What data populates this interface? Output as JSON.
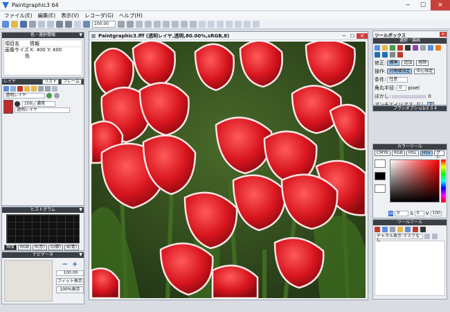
{
  "app": {
    "title": "Paintgraphic3 64"
  },
  "menu": [
    "ファイル(E)",
    "編集(E)",
    "表示(V)",
    "レコーダ(G)",
    "ヘルプ(H)"
  ],
  "toolbar": {
    "zoom": "100.00"
  },
  "info_panel": {
    "title": "色・選択情報",
    "col_item": "項目名",
    "col_info": "情報",
    "size_label": "画像サイズ",
    "size_value": "X: 400 Y: 400",
    "color_label": "色"
  },
  "layer_panel": {
    "title": "レイヤ",
    "tab1": "リスト",
    "tab2": "フレーム",
    "mode": "透明レイヤ",
    "opacity": "100",
    "blend": "通常",
    "layer_name": "透明レイヤ"
  },
  "histogram": {
    "title": "ヒストグラム",
    "tabs": [
      "輝度",
      "RGB",
      "R(赤)",
      "G(緑)",
      "B(青)"
    ]
  },
  "navigator": {
    "title": "ナビゲータ",
    "minus": "−",
    "plus": "+",
    "zoom": "100.00",
    "fit": "フィット表示",
    "actual": "100%表示"
  },
  "document": {
    "title": "Paintgraphic3.fff (透明レイヤ,透明,80.00%,sRGB,8)"
  },
  "toolbox": {
    "title": "ツールボックス",
    "sub": "選択・描画",
    "edit_label": "修正:",
    "edit_opts": [
      "標準",
      "追加",
      "削除"
    ],
    "op_label": "操作:",
    "op_opts": [
      "対角線指定",
      "中心指定"
    ],
    "cond_label": "条件:",
    "cond_value": "任意",
    "radius_label": "角丸半径:",
    "radius_value": "0",
    "radius_unit": "pixel",
    "blur_label": "ぼかし:",
    "blur_value": "0",
    "aa_label": "アンチエイリアス:",
    "aa_value": "なし",
    "aa_num": "1"
  },
  "brush_panel": {
    "title": "ブラシオプション",
    "tabs": [
      "1",
      "2",
      "3",
      "4"
    ]
  },
  "color_panel": {
    "title": "カラーツール",
    "tabs": [
      "CMYK",
      "RGB",
      "HSL",
      "HSV",
      "グレー"
    ],
    "h": "0",
    "s": "0",
    "v": "100",
    "h_label": "H",
    "s_label": "S",
    "v_label": "V"
  },
  "tool_panel": {
    "title": "ツールツール",
    "channel": "チャネル表示:マスクなし"
  },
  "colors": {
    "accent": "#2b6fd6",
    "dark_header": "#3b3f46",
    "red": "#d8151e"
  }
}
